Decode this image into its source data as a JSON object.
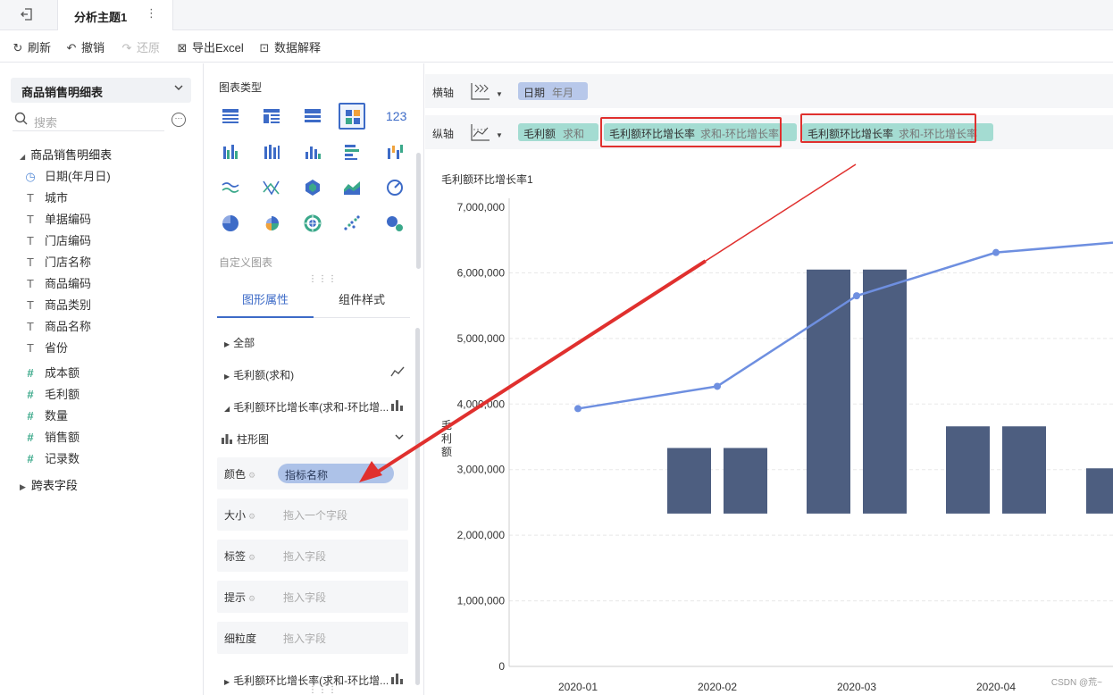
{
  "tabbar": {
    "title": "分析主题1",
    "more": "⋮"
  },
  "toolbar": {
    "refresh": "刷新",
    "undo": "撤销",
    "redo": "还原",
    "export_excel": "导出Excel",
    "data_explain": "数据解释"
  },
  "left": {
    "dataset": "商品销售明细表",
    "search_placeholder": "搜索",
    "tree_root": "商品销售明细表",
    "fields": [
      {
        "type": "date",
        "icon": "◷",
        "label": "日期(年月日)"
      },
      {
        "type": "text",
        "icon": "T",
        "label": "城市"
      },
      {
        "type": "text",
        "icon": "T",
        "label": "单据编码"
      },
      {
        "type": "text",
        "icon": "T",
        "label": "门店编码"
      },
      {
        "type": "text",
        "icon": "T",
        "label": "门店名称"
      },
      {
        "type": "text",
        "icon": "T",
        "label": "商品编码"
      },
      {
        "type": "text",
        "icon": "T",
        "label": "商品类别"
      },
      {
        "type": "text",
        "icon": "T",
        "label": "商品名称"
      },
      {
        "type": "text",
        "icon": "T",
        "label": "省份"
      },
      {
        "type": "num",
        "icon": "#",
        "label": "成本额"
      },
      {
        "type": "num",
        "icon": "#",
        "label": "毛利额"
      },
      {
        "type": "num",
        "icon": "#",
        "label": "数量"
      },
      {
        "type": "num",
        "icon": "#",
        "label": "销售额"
      },
      {
        "type": "num",
        "icon": "#",
        "label": "记录数"
      }
    ],
    "cross_table": "跨表字段"
  },
  "middle": {
    "chart_type_title": "图表类型",
    "custom_chart": "自定义图表",
    "tab_graphic": "图形属性",
    "tab_component": "组件样式",
    "prop_all": "全部",
    "prop_profit": "毛利额(求和)",
    "prop_ratio1": "毛利额环比增长率(求和-环比增...",
    "bar_type": "柱形图",
    "slots": [
      {
        "label": "颜色",
        "value": "指标名称"
      },
      {
        "label": "大小",
        "placeholder": "拖入一个字段"
      },
      {
        "label": "标签",
        "placeholder": "拖入字段"
      },
      {
        "label": "提示",
        "placeholder": "拖入字段"
      },
      {
        "label": "细粒度",
        "placeholder": "拖入字段"
      }
    ],
    "prop_ratio2": "毛利额环比增长率(求和-环比增...",
    "tiles_123": "123"
  },
  "axes": {
    "x_label": "横轴",
    "y_label": "纵轴",
    "x_field": {
      "name": "日期",
      "sub": "年月"
    },
    "y_fields": [
      {
        "name": "毛利额",
        "sub": "求和"
      },
      {
        "name": "毛利额环比增长率",
        "sub": "求和-环比增长率"
      },
      {
        "name": "毛利额环比增长率",
        "sub": "求和-环比增长率"
      }
    ]
  },
  "chart_title": "毛利额环比增长率1",
  "watermark": "CSDN @荒~",
  "colors": {
    "bar": "#4d5e80",
    "line": "#6e8fe0",
    "accent": "#3d6bc7",
    "annotation": "#e0302e"
  },
  "chart_data": {
    "type": "bar",
    "categories": [
      "2020-01",
      "2020-02",
      "2020-03",
      "2020-04"
    ],
    "ylabel": "毛利额",
    "ylim": [
      0,
      7000000
    ],
    "yticks": [
      "7,000,000",
      "6,000,000",
      "5,000,000",
      "4,000,000",
      "3,000,000",
      "2,000,000",
      "1,000,000",
      "0"
    ],
    "series": [
      {
        "kind": "bar",
        "values": [
          null,
          3330000,
          6050000,
          3660000
        ]
      },
      {
        "kind": "bar",
        "values": [
          null,
          3330000,
          6050000,
          3660000
        ]
      },
      {
        "kind": "line",
        "values": [
          3930000,
          4270000,
          5650000,
          6310000
        ]
      }
    ]
  }
}
